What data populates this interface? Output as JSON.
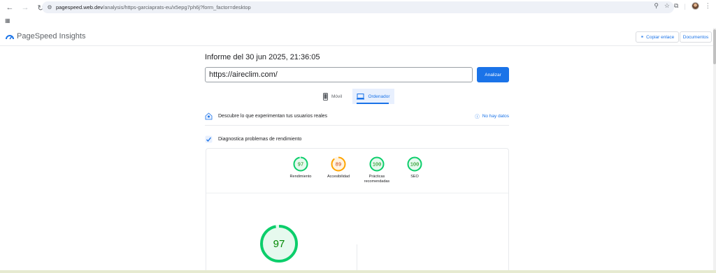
{
  "browser": {
    "url_host": "pagespeed.web.dev",
    "url_path": "/analysis/https-garciaprats-eu/x5epg7ph6j?form_factor=desktop"
  },
  "header": {
    "app_title": "PageSpeed Insights",
    "copy_link_label": "Copiar enlace",
    "docs_label": "Documentos"
  },
  "report": {
    "date_label": "Informe del 30 jun 2025, 21:36:05",
    "url_value": "https://aireclim.com/",
    "analyze_label": "Analizar"
  },
  "tabs": [
    {
      "label": "Móvil",
      "active": false
    },
    {
      "label": "Ordenador",
      "active": true
    }
  ],
  "sections": {
    "field_title": "Descubre lo que experimentan tus usuarios reales",
    "no_data_label": "No hay datos",
    "lab_title": "Diagnostica problemas de rendimiento"
  },
  "scores": [
    {
      "label": "Rendimiento",
      "value": "97",
      "fraction": 0.97,
      "color": "#0cce6b",
      "text_color": "#008800"
    },
    {
      "label": "Accesibilidad",
      "value": "89",
      "fraction": 0.89,
      "color": "#ffa400",
      "text_color": "#c33300"
    },
    {
      "label": "Prácticas recomendadas",
      "value": "100",
      "fraction": 1.0,
      "color": "#0cce6b",
      "text_color": "#008800"
    },
    {
      "label": "SEO",
      "value": "100",
      "fraction": 1.0,
      "color": "#0cce6b",
      "text_color": "#008800"
    }
  ],
  "main_score": {
    "value": "97",
    "fraction": 0.97,
    "color": "#0cce6b",
    "text_color": "#008800"
  },
  "colors": {
    "accent": "#1a73e8",
    "pass": "#0cce6b",
    "average": "#ffa400"
  }
}
